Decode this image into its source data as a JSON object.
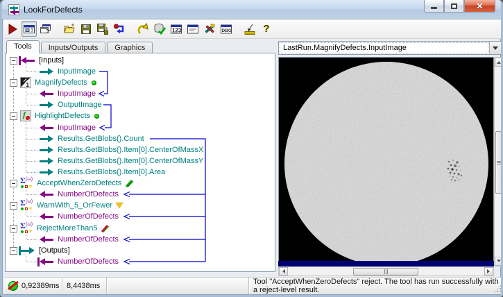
{
  "window": {
    "title": "LookForDefects"
  },
  "toolbar": {
    "buttons": [
      {
        "name": "run"
      },
      {
        "name": "show-image-window",
        "pressed": true
      },
      {
        "name": "new-image-window"
      },
      {
        "name": "open-file"
      },
      {
        "name": "save-file"
      },
      {
        "name": "save-file-as"
      },
      {
        "name": "import"
      },
      {
        "name": "undo"
      },
      {
        "name": "database-check"
      },
      {
        "name": "calibration-123",
        "glyph_text": "123"
      },
      {
        "name": "properties-window"
      },
      {
        "name": "tools-options"
      },
      {
        "name": "debug-window",
        "glyph_text": "DBG"
      },
      {
        "name": "probe"
      },
      {
        "name": "help",
        "glyph_text": "?"
      }
    ]
  },
  "tabs": {
    "items": [
      "Tools",
      "Inputs/Outputs",
      "Graphics"
    ],
    "active": "Tools"
  },
  "tree": {
    "items": [
      {
        "label": "[Inputs]",
        "kind": "inputs-terminal"
      },
      {
        "label": "InputImage",
        "kind": "output-pin"
      },
      {
        "label": "MagnifyDefects",
        "kind": "image-tool",
        "status": "ok"
      },
      {
        "label": "InputImage",
        "kind": "input-pin"
      },
      {
        "label": "OutputImage",
        "kind": "output-pin"
      },
      {
        "label": "HighlightDefects",
        "kind": "blob-tool",
        "status": "ok"
      },
      {
        "label": "InputImage",
        "kind": "input-pin"
      },
      {
        "label": "Results.GetBlobs().Count",
        "kind": "output-pin"
      },
      {
        "label": "Results.GetBlobs().Item[0].CenterOfMassX",
        "kind": "output-pin"
      },
      {
        "label": "Results.GetBlobs().Item[0].CenterOfMassY",
        "kind": "output-pin"
      },
      {
        "label": "Results.GetBlobs().Item[0].Area",
        "kind": "output-pin"
      },
      {
        "label": "AcceptWhenZeroDefects",
        "kind": "results-analysis-tool",
        "status": "accept"
      },
      {
        "label": "NumberOfDefects",
        "kind": "input-pin"
      },
      {
        "label": "WarnWith_5_OrFewer",
        "kind": "results-analysis-tool",
        "status": "warn"
      },
      {
        "label": "NumberOfDefects",
        "kind": "input-pin"
      },
      {
        "label": "RejectMoreThan5",
        "kind": "results-analysis-tool",
        "status": "reject"
      },
      {
        "label": "NumberOfDefects",
        "kind": "input-pin"
      },
      {
        "label": "[Outputs]",
        "kind": "outputs-terminal"
      },
      {
        "label": "NumberOfDefects",
        "kind": "input-pin"
      }
    ]
  },
  "image_panel": {
    "selected_image": "LastRun.MagnifyDefects.InputImage"
  },
  "status_bar": {
    "icon": "reject-indicator-icon",
    "run_time": "0,92389ms",
    "total_time": "8,4438ms",
    "message": "Tool \"AcceptWhenZeroDefects\" reject. The tool has run successfully with a reject-level result."
  },
  "colors": {
    "connector_blue": "#0000cc",
    "output_pin_teal": "#008080",
    "input_pin_purple": "#850885",
    "accept_green": "#00b400",
    "warn_yellow": "#f2c500",
    "reject_red": "#e00000"
  }
}
